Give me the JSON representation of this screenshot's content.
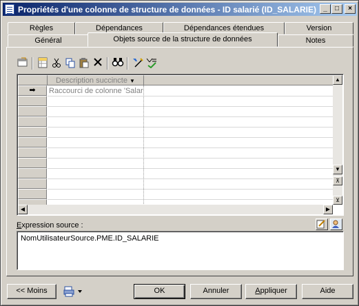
{
  "window": {
    "title": "Propriétés d'une colonne de structure de données - ID salarié (ID_SALARIE)",
    "controls": [
      "_",
      "□",
      "×"
    ]
  },
  "tabs": {
    "row_back": [
      {
        "label": "Règles"
      },
      {
        "label": "Dépendances"
      },
      {
        "label": "Dépendances étendues"
      },
      {
        "label": "Version"
      }
    ],
    "row_front": [
      {
        "label": "Général"
      },
      {
        "label": "Objets source de la structure de données",
        "active": true
      },
      {
        "label": "Notes"
      }
    ]
  },
  "toolbar": {
    "icons": [
      "properties-icon",
      "add-rows-icon",
      "cut-icon",
      "copy-icon",
      "paste-icon",
      "delete-icon",
      "find-icon",
      "customize-columns-icon",
      "filter-icon"
    ]
  },
  "grid": {
    "column_header": "Description succincte",
    "rows": [
      {
        "indicator": "➡",
        "description": "Raccourci de colonne 'Salari"
      }
    ],
    "empty_rows": 12
  },
  "expression": {
    "label_prefix": "E",
    "label_rest": "xpression source :",
    "value": "NomUtilisateurSource.PME.ID_SALARIE"
  },
  "buttons": {
    "less": "<< Moins",
    "ok": "OK",
    "cancel": "Annuler",
    "apply_first": "A",
    "apply_rest": "ppliquer",
    "help": "Aide"
  }
}
